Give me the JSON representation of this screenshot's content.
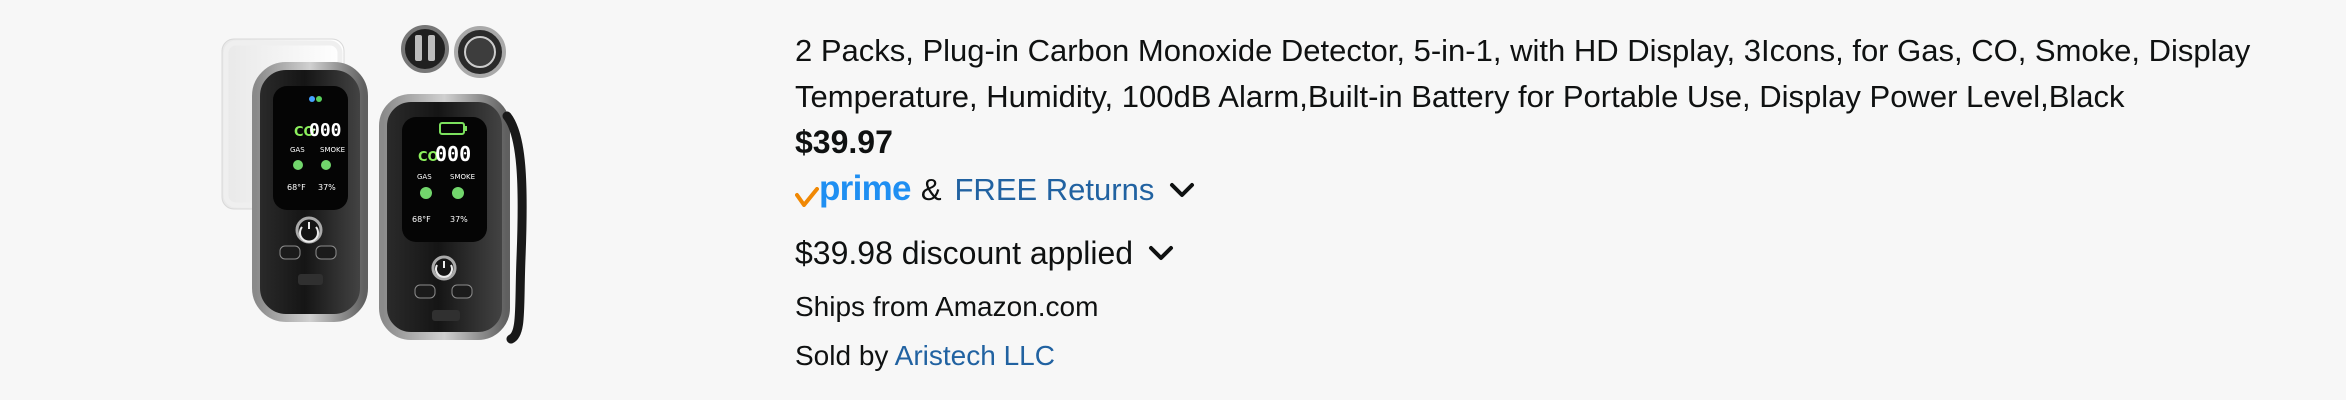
{
  "product": {
    "title": "2 Packs, Plug-in Carbon Monoxide Detector, 5-in-1, with HD Display, 3Icons, for Gas, CO, Smoke, Display Temperature, Humidity, 100dB Alarm,Built-in Battery for Portable Use, Display Power Level,Black",
    "price": "$39.97",
    "prime_label": "prime",
    "ampersand": "&",
    "free_returns": "FREE Returns",
    "discount": "$39.98 discount applied",
    "ships_from": "Ships from Amazon.com",
    "sold_by_prefix": "Sold by ",
    "seller": "Aristech LLC"
  },
  "image_screen": {
    "co": "CO",
    "digits": "000",
    "gas": "GAS",
    "smoke": "SMOKE",
    "temp": "68°F",
    "humidity": "37%"
  },
  "colors": {
    "background": "#f7f7f7",
    "text": "#0f1111",
    "link": "#2162a1",
    "prime": "#1f8ff2",
    "prime_check": "#f08804"
  }
}
